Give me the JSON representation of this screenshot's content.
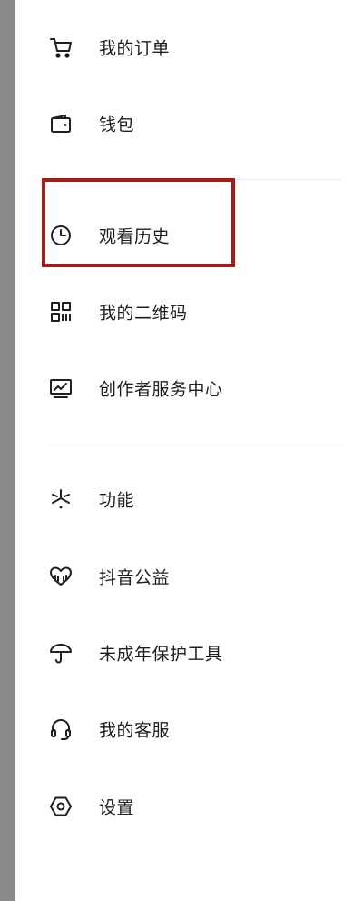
{
  "menu": {
    "items": [
      {
        "label": "我的订单",
        "icon": "cart-icon"
      },
      {
        "label": "钱包",
        "icon": "wallet-icon"
      },
      {
        "label": "观看历史",
        "icon": "clock-icon"
      },
      {
        "label": "我的二维码",
        "icon": "qr-code-icon"
      },
      {
        "label": "创作者服务中心",
        "icon": "monitor-chart-icon"
      },
      {
        "label": "功能",
        "icon": "spark-icon"
      },
      {
        "label": "抖音公益",
        "icon": "heart-hands-icon"
      },
      {
        "label": "未成年保护工具",
        "icon": "umbrella-icon"
      },
      {
        "label": "我的客服",
        "icon": "headset-icon"
      },
      {
        "label": "设置",
        "icon": "settings-hexagon-icon"
      }
    ]
  },
  "colors": {
    "text": "#1f1f1f",
    "divider": "#ededed",
    "highlight": "#a51c1c",
    "left_edge": "#8a8a8a"
  }
}
